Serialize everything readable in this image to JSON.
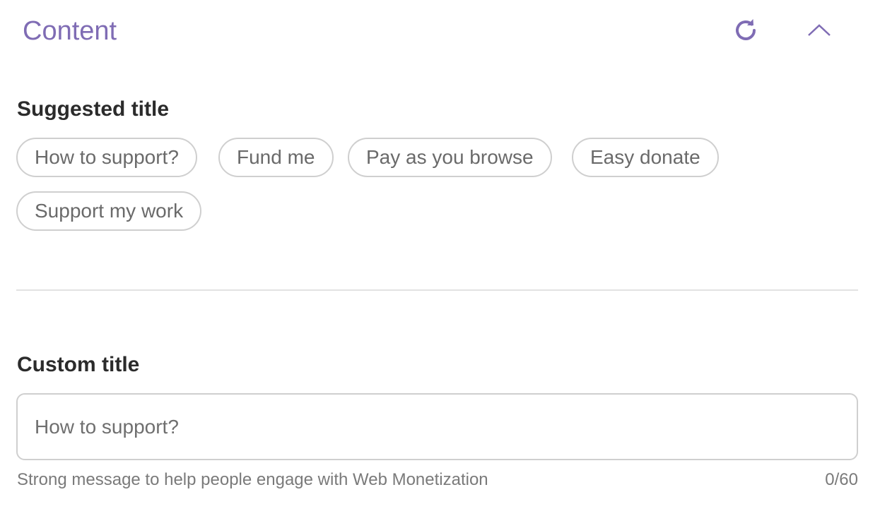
{
  "header": {
    "title": "Content",
    "refresh_icon": "refresh-icon",
    "collapse_icon": "chevron-up-icon"
  },
  "suggested": {
    "label": "Suggested title",
    "chips": [
      "How to support?",
      "Fund me",
      "Pay as you browse",
      "Easy donate",
      "Support my work"
    ]
  },
  "custom": {
    "label": "Custom title",
    "input_value": "",
    "input_placeholder": "How to support?",
    "helper": "Strong message to help people engage with Web Monetization",
    "counter": "0/60"
  },
  "colors": {
    "accent": "#7f6cb4",
    "heading": "#2b2b2b",
    "border": "#cfcfcf",
    "muted_text": "#6a6a6a"
  }
}
